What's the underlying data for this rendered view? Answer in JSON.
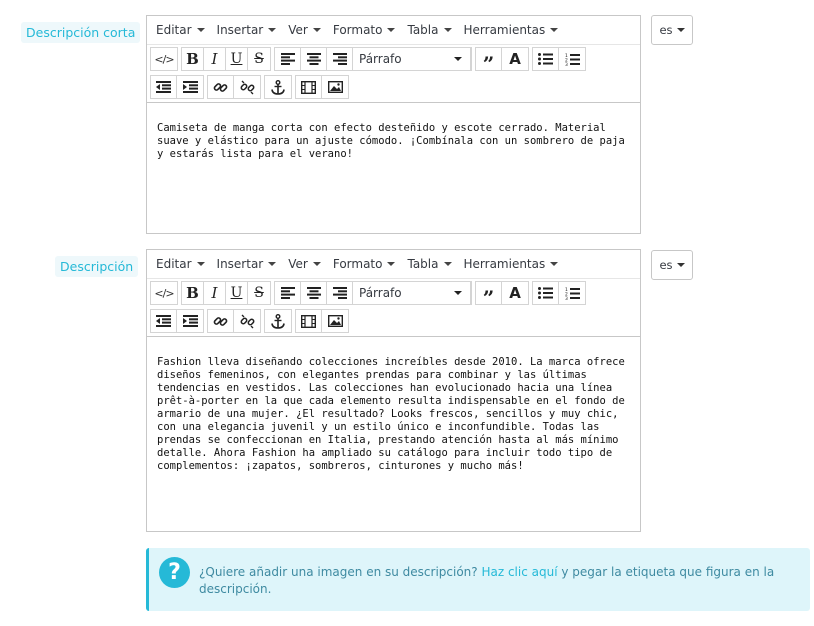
{
  "fields": [
    {
      "label": "Descripción corta",
      "language": "es",
      "menus": [
        "Editar",
        "Insertar",
        "Ver",
        "Formato",
        "Tabla",
        "Herramientas"
      ],
      "format_value": "Párrafo",
      "content": "Camiseta de manga corta con efecto desteñido y escote cerrado. Material suave y elástico para un ajuste cómodo. ¡Combínala con un sombrero de paja y estarás lista para el verano!"
    },
    {
      "label": "Descripción",
      "language": "es",
      "menus": [
        "Editar",
        "Insertar",
        "Ver",
        "Formato",
        "Tabla",
        "Herramientas"
      ],
      "format_value": "Párrafo",
      "content": "Fashion lleva diseñando colecciones increíbles desde 2010. La marca ofrece diseños femeninos, con elegantes prendas para combinar y las últimas tendencias en vestidos. Las colecciones han evolucionado hacia una línea prêt-à-porter en la que cada elemento resulta indispensable en el fondo de armario de una mujer. ¿El resultado? Looks frescos, sencillos y muy chic, con una elegancia juvenil y un estilo único e inconfundible. Todas las prendas se confeccionan en Italia, prestando atención hasta al más mínimo detalle. Ahora Fashion ha ampliado su catálogo para incluir todo tipo de complementos: ¡zapatos, sombreros, cinturones y mucho más!"
    }
  ],
  "info": {
    "icon": "question-icon",
    "question_text": "¿Quiere añadir una imagen en su descripción? ",
    "link_text": "Haz clic aquí",
    "tail_text": " y pegar la etiqueta que figura en la descripción."
  },
  "colors": {
    "accent": "#25b9d7",
    "info_bg": "#def5fa",
    "label_bg": "#eef8fb",
    "border": "#c7c7c7"
  }
}
